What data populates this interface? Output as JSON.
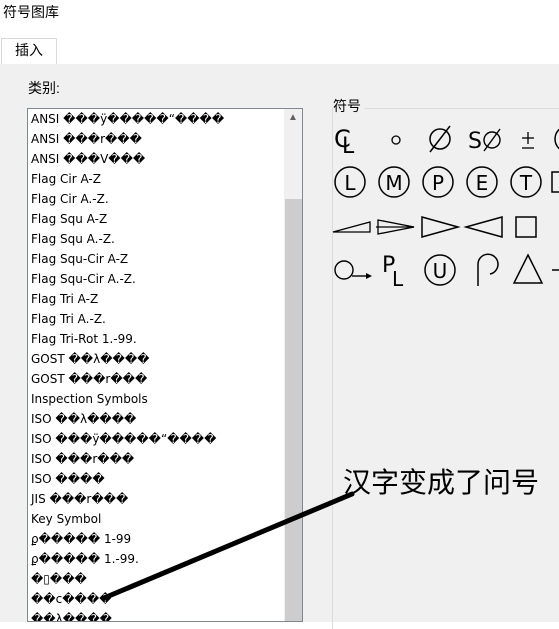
{
  "window": {
    "title": "符号图库"
  },
  "tabs": [
    {
      "label": "插入"
    }
  ],
  "category": {
    "label": "类别:",
    "items": [
      "ANSI ���ÿ�����“����",
      "ANSI ���r���",
      "ANSI ���V���",
      "Flag Cir A-Z",
      "Flag Cir A.-Z.",
      "Flag Squ A-Z",
      "Flag Squ A.-Z.",
      "Flag Squ-Cir A-Z",
      "Flag Squ-Cir A.-Z.",
      "Flag Tri A-Z",
      "Flag Tri A.-Z.",
      "Flag Tri-Rot 1.-99.",
      "GOST ��λ����",
      "GOST ���r���",
      "Inspection Symbols",
      "ISO ��λ����",
      "ISO ���ÿ�����“����",
      "ISO ���r���",
      "ISO ����",
      "JIS ���r���",
      "Key Symbol",
      "ϼ����� 1-99",
      "ϼ����� 1.-99.",
      "�▯���",
      "��c����",
      "��λ����"
    ]
  },
  "symbols": {
    "label": "符号",
    "row1": [
      "CL",
      "°",
      "⌀",
      "S⌀",
      "±",
      "("
    ],
    "row2": [
      "L",
      "M",
      "P",
      "E",
      "T"
    ],
    "row4": [
      "P",
      "L",
      "U"
    ]
  },
  "annotation": {
    "text": "汉字变成了问号"
  }
}
